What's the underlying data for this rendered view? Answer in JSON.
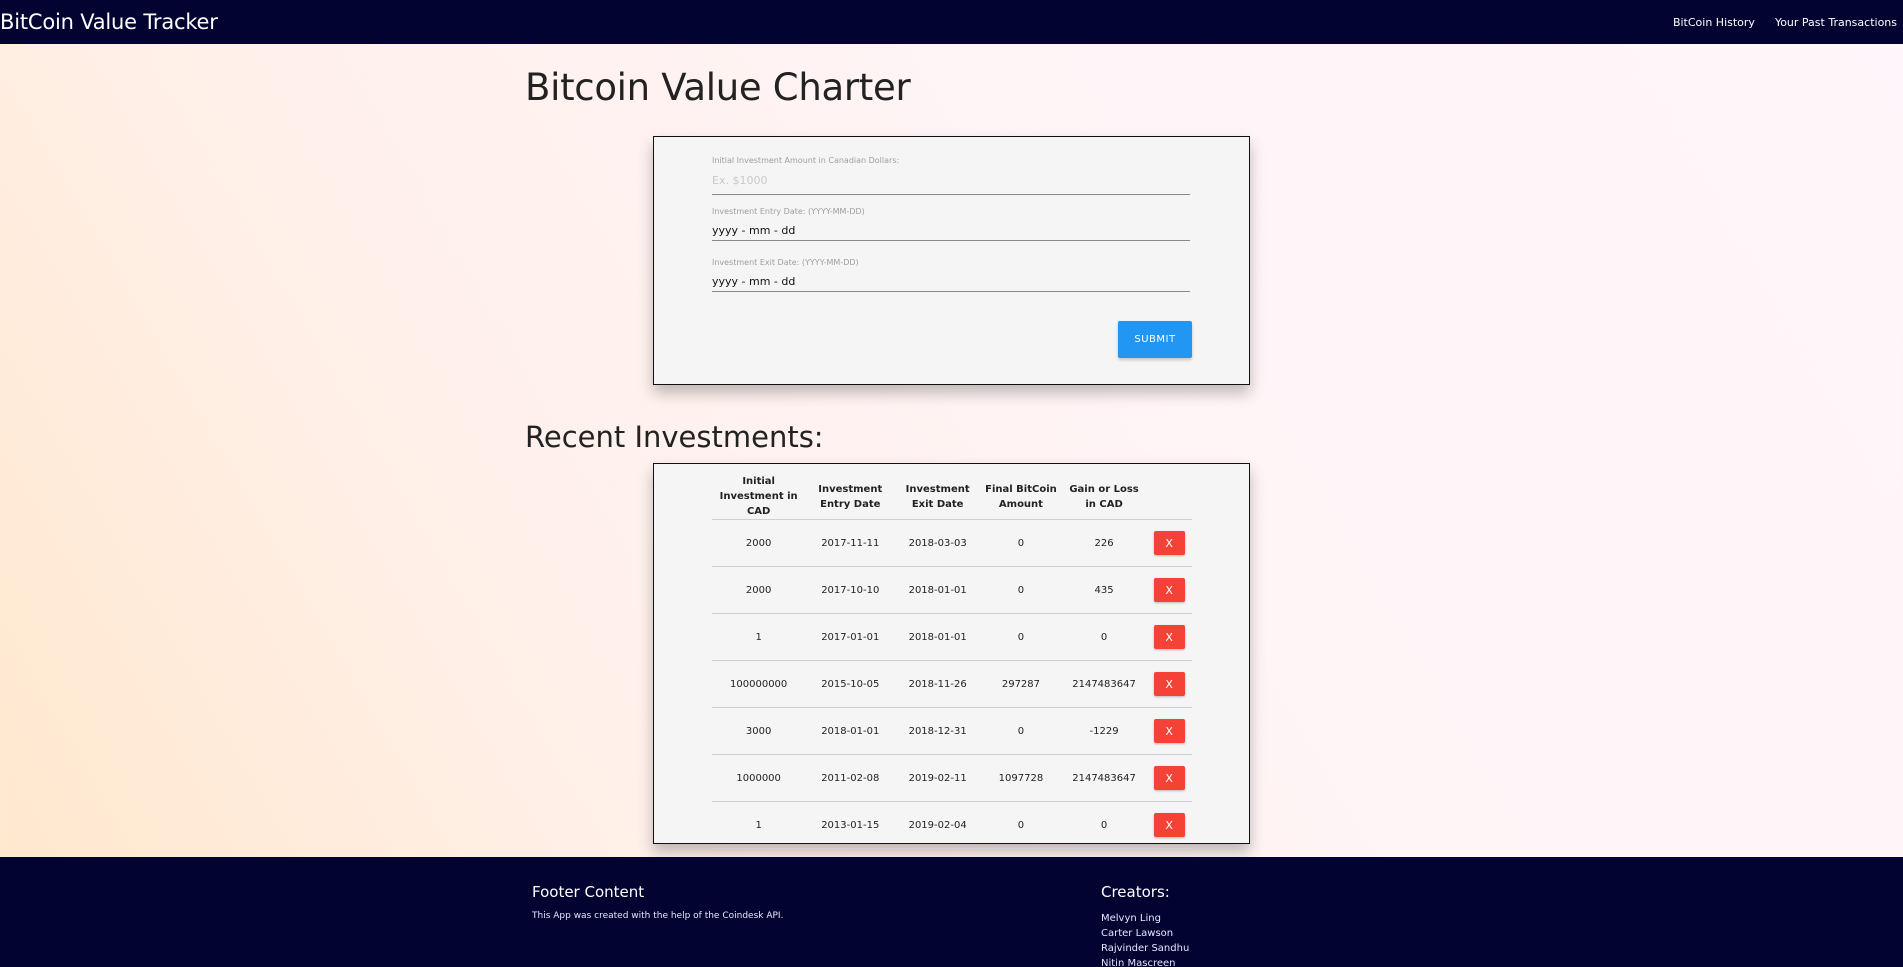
{
  "navbar": {
    "brand": "BitCoin Value Tracker",
    "links": [
      "BitCoin History",
      "Your Past Transactions"
    ]
  },
  "page_title": "Bitcoin Value Charter",
  "form": {
    "amount_label": "Initial Investment Amount in Canadian Dollars:",
    "amount_placeholder": "Ex. $1000",
    "entry_label": "Investment Entry Date: (YYYY-MM-DD)",
    "entry_value": "yyyy - mm - dd",
    "exit_label": "Investment Exit Date: (YYYY-MM-DD)",
    "exit_value": "yyyy - mm - dd",
    "submit_label": "SUBMIT"
  },
  "section_title": "Recent Investments:",
  "table": {
    "headers": [
      "Initial Investment in CAD",
      "Investment Entry Date",
      "Investment Exit Date",
      "Final BitCoin Amount",
      "Gain or Loss in CAD"
    ],
    "delete_label": "X",
    "rows": [
      [
        "2000",
        "2017-11-11",
        "2018-03-03",
        "0",
        "226"
      ],
      [
        "2000",
        "2017-10-10",
        "2018-01-01",
        "0",
        "435"
      ],
      [
        "1",
        "2017-01-01",
        "2018-01-01",
        "0",
        "0"
      ],
      [
        "100000000",
        "2015-10-05",
        "2018-11-26",
        "297287",
        "2147483647"
      ],
      [
        "3000",
        "2018-01-01",
        "2018-12-31",
        "0",
        "-1229"
      ],
      [
        "1000000",
        "2011-02-08",
        "2019-02-11",
        "1097728",
        "2147483647"
      ],
      [
        "1",
        "2013-01-15",
        "2019-02-04",
        "0",
        "0"
      ]
    ]
  },
  "footer": {
    "heading": "Footer Content",
    "text": "This App was created with the help of the Coindesk API.",
    "creators_heading": "Creators:",
    "creators": [
      "Melvyn Ling",
      "Carter Lawson",
      "Rajvinder Sandhu",
      "Nitin Mascreen"
    ]
  }
}
